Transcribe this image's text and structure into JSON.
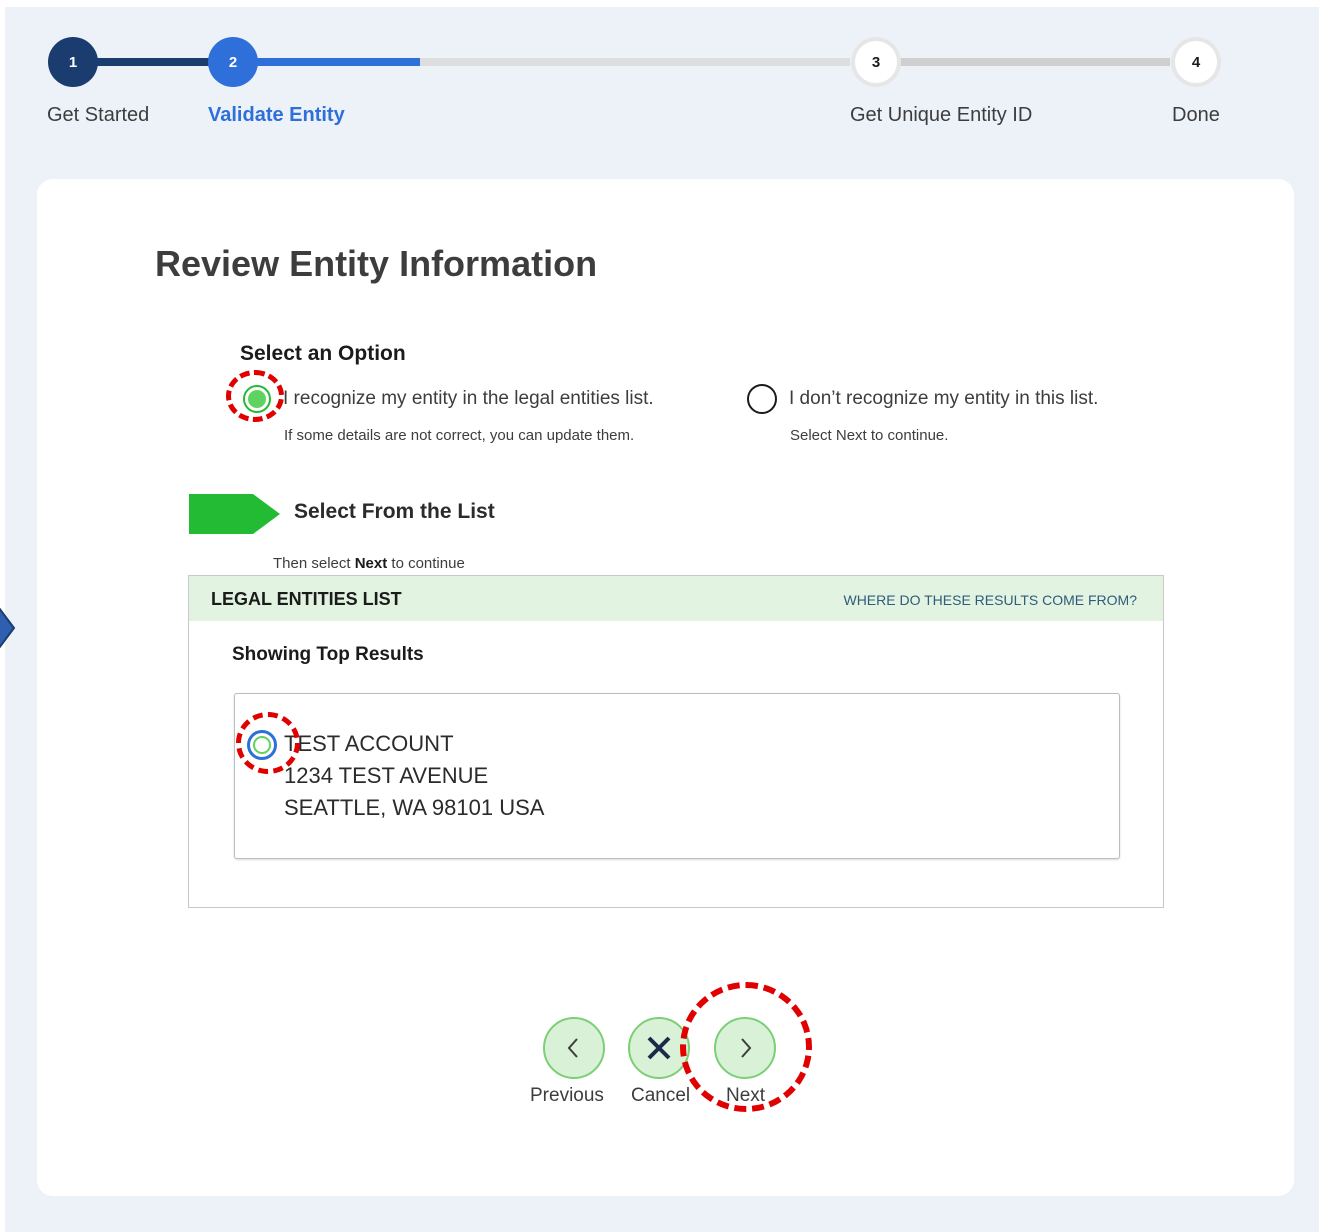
{
  "stepper": {
    "steps": [
      {
        "number": "1",
        "label": "Get Started",
        "state": "complete"
      },
      {
        "number": "2",
        "label": "Validate Entity",
        "state": "current"
      },
      {
        "number": "3",
        "label": "Get Unique Entity ID",
        "state": "upcoming"
      },
      {
        "number": "4",
        "label": "Done",
        "state": "upcoming"
      }
    ]
  },
  "page": {
    "title": "Review Entity Information"
  },
  "options": {
    "heading": "Select an Option",
    "recognize": {
      "label": "I recognize my entity in the legal entities list.",
      "hint": "If some details are not correct, you can update them.",
      "selected": true
    },
    "not_recognize": {
      "label": "I don’t recognize my entity in this list.",
      "hint": "Select Next to continue.",
      "selected": false
    }
  },
  "select_list": {
    "heading": "Select From the List",
    "instruction_prefix": "Then select ",
    "instruction_bold": "Next",
    "instruction_suffix": " to continue"
  },
  "results_panel": {
    "title": "LEGAL ENTITIES LIST",
    "source_link": "WHERE DO THESE RESULTS COME FROM?",
    "subheading": "Showing Top Results",
    "entity": {
      "name": "TEST ACCOUNT",
      "street": "1234 TEST AVENUE",
      "city_line": "SEATTLE, WA 98101 USA",
      "selected": true
    }
  },
  "footer_nav": {
    "previous_label": "Previous",
    "cancel_label": "Cancel",
    "next_label": "Next"
  },
  "colors": {
    "stepper_complete": "#1a3c6e",
    "stepper_current": "#2e6fd9",
    "accent_green": "#22bb33",
    "panel_header_bg": "#e3f3e1",
    "annotation_red": "#e10000"
  },
  "icons": {
    "previous": "chevron-left-icon",
    "cancel": "close-icon",
    "next": "chevron-right-icon",
    "section_marker": "green-arrow-icon",
    "side_pointer": "arrow-pointer-icon"
  }
}
